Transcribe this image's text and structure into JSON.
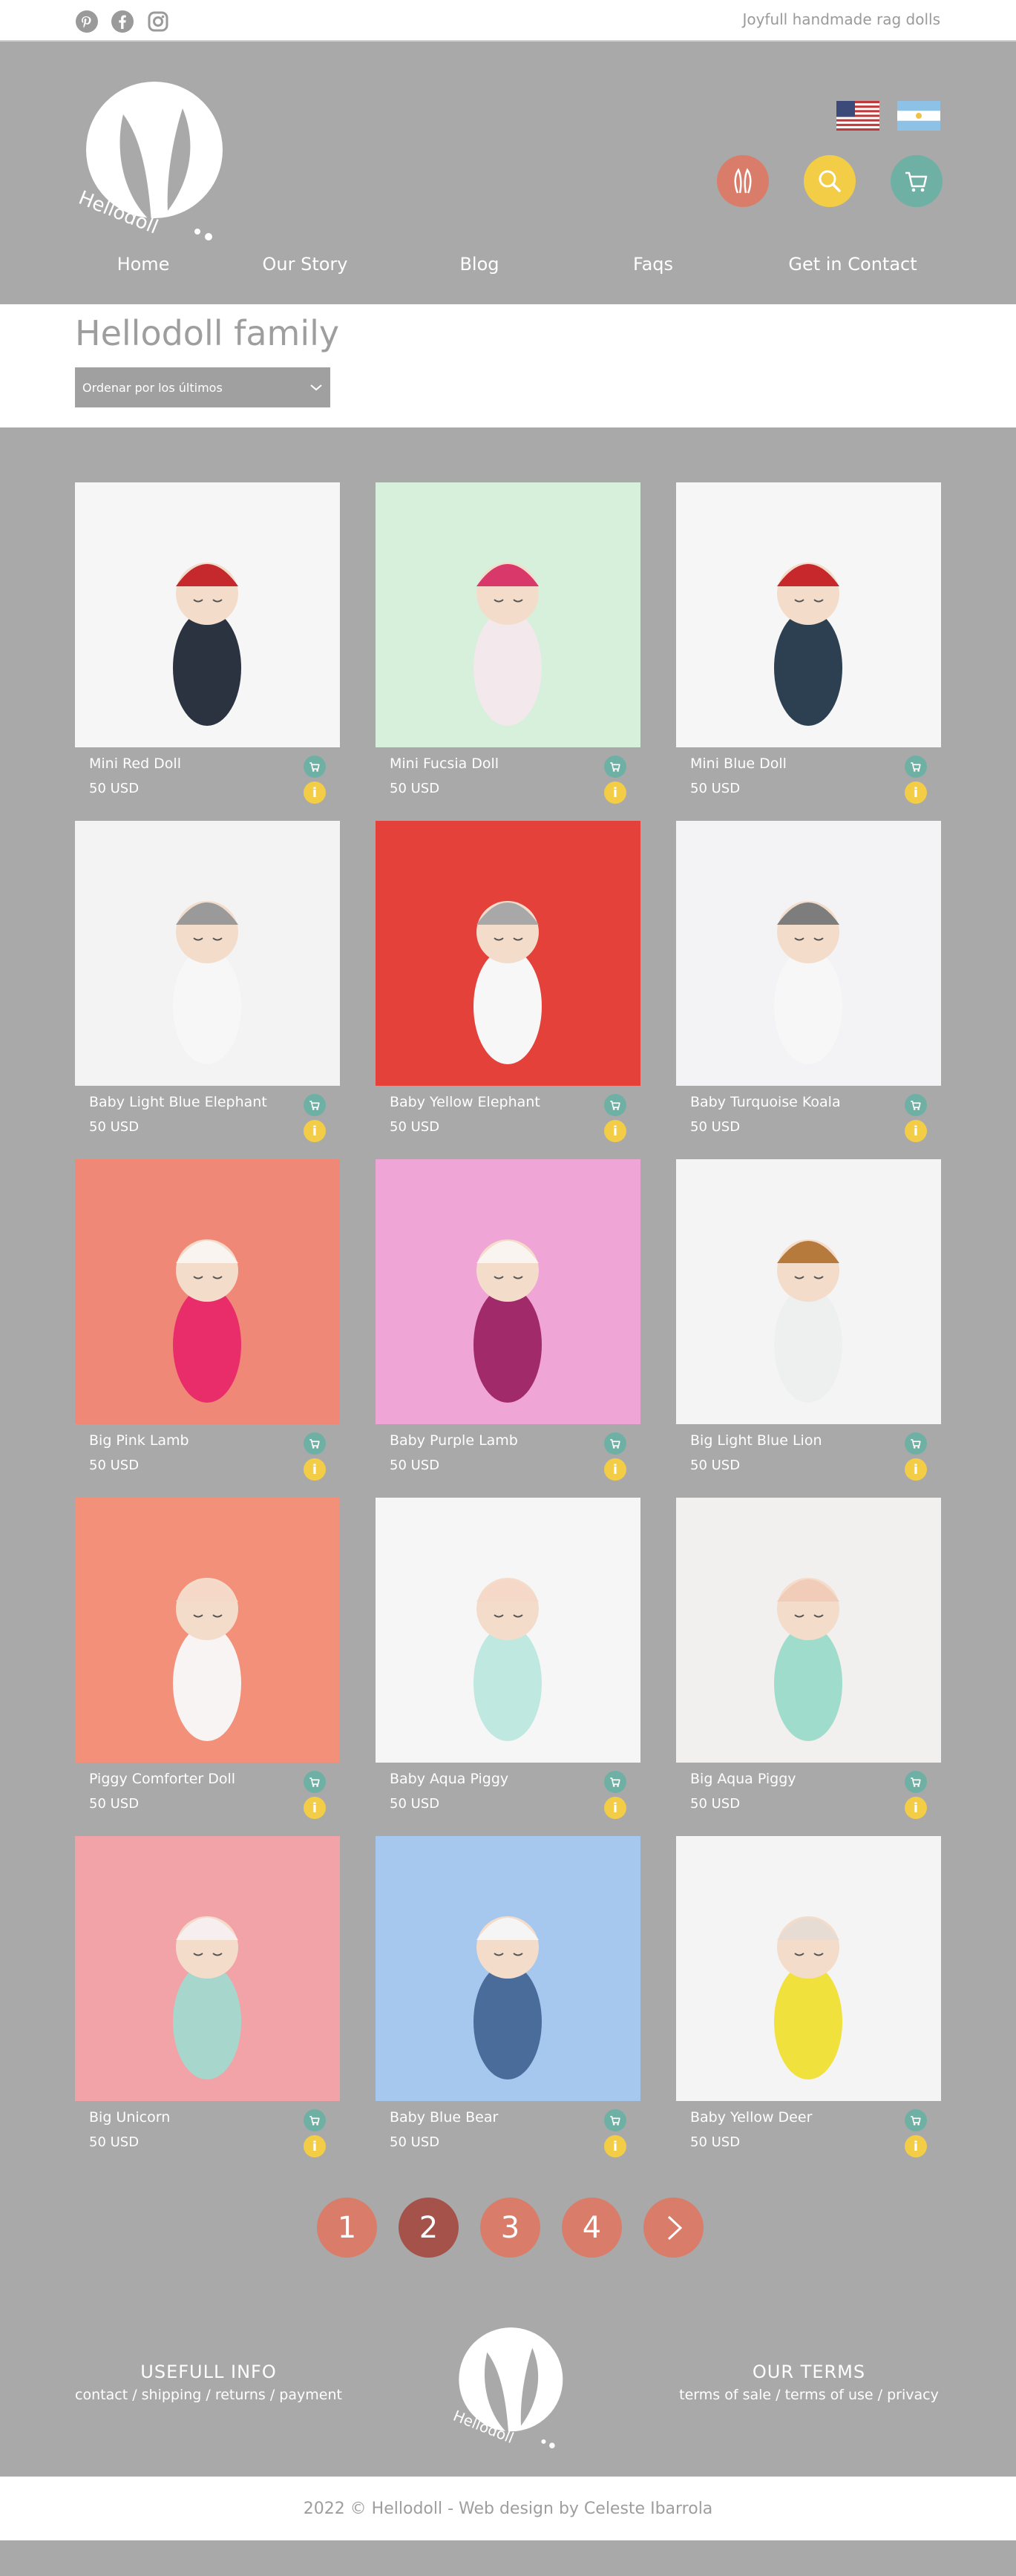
{
  "topbar": {
    "tagline": "Joyfull handmade rag dolls",
    "social": [
      "pinterest-icon",
      "facebook-icon",
      "instagram-icon"
    ]
  },
  "header": {
    "logo_text": "Hellodoll",
    "flags": [
      "us-flag",
      "argentina-flag"
    ],
    "icons": [
      "bunny-ears-icon",
      "search-icon",
      "cart-icon"
    ],
    "nav": [
      "Home",
      "Our Story",
      "Blog",
      "Faqs",
      "Get in Contact"
    ]
  },
  "catalog": {
    "title": "Hellodoll family",
    "sort_label": "Ordenar por los últimos",
    "products": [
      {
        "name": "Mini Red Doll",
        "price": "50 USD",
        "bg": "#f6f6f6",
        "hat": "#c5292d",
        "body": "#2b3240"
      },
      {
        "name": "Mini Fucsia Doll",
        "price": "50 USD",
        "bg": "#d7f0dc",
        "hat": "#d8396a",
        "body": "#f3e8ec"
      },
      {
        "name": "Mini Blue Doll",
        "price": "50 USD",
        "bg": "#f6f6f6",
        "hat": "#c7282c",
        "body": "#2d4051"
      },
      {
        "name": "Baby Light Blue Elephant",
        "price": "50 USD",
        "bg": "#f3f3f3",
        "hat": "#9a9a9a",
        "body": "#f7f7f7"
      },
      {
        "name": "Baby Yellow Elephant",
        "price": "50 USD",
        "bg": "#e4413b",
        "hat": "#a8a8a8",
        "body": "#f7f7f7"
      },
      {
        "name": "Baby Turquoise Koala",
        "price": "50 USD",
        "bg": "#f3f3f5",
        "hat": "#7d7d7d",
        "body": "#f7f7f7"
      },
      {
        "name": "Big Pink Lamb",
        "price": "50 USD",
        "bg": "#f08878",
        "hat": "#f9f4ef",
        "body": "#e92c6a"
      },
      {
        "name": "Baby Purple Lamb",
        "price": "50 USD",
        "bg": "#efa5d6",
        "hat": "#f9f4ef",
        "body": "#a02a6a"
      },
      {
        "name": "Big Light Blue Lion",
        "price": "50 USD",
        "bg": "#f4f4f4",
        "hat": "#b77a3d",
        "body": "#eef0f0"
      },
      {
        "name": "Piggy Comforter Doll",
        "price": "50 USD",
        "bg": "#f3907a",
        "hat": "#f6d8c8",
        "body": "#f8f4f4"
      },
      {
        "name": "Baby Aqua Piggy",
        "price": "50 USD",
        "bg": "#f6f6f6",
        "hat": "#f6d8c8",
        "body": "#bfe8e0"
      },
      {
        "name": "Big Aqua Piggy",
        "price": "50 USD",
        "bg": "#f2efef",
        "hat": "#f1cdb9",
        "body": "#9fdccc"
      },
      {
        "name": "Big Unicorn",
        "price": "50 USD",
        "bg": "#f2a3a8",
        "hat": "#f7eef0",
        "body": "#a6d6cc"
      },
      {
        "name": "Baby Blue Bear",
        "price": "50 USD",
        "bg": "#a7c8ee",
        "hat": "#f5f5f5",
        "body": "#4a6c9b"
      },
      {
        "name": "Baby Yellow Deer",
        "price": "50 USD",
        "bg": "#f4f4f4",
        "hat": "#e7dcd3",
        "body": "#f1e13d"
      }
    ]
  },
  "pagination": {
    "pages": [
      "1",
      "2",
      "3",
      "4"
    ],
    "active": "2",
    "next": "next-arrow-icon"
  },
  "footer": {
    "left_heading": "USEFULL INFO",
    "left_links": "contact / shipping / returns / payment",
    "right_heading": "OUR TERMS",
    "right_links": "terms of sale / terms of use / privacy",
    "logo_text": "Hellodoll",
    "copyright": "2022 © Hellodoll - Web design by Celeste Ibarrola"
  },
  "colors": {
    "background": "#a9a9a9",
    "coral": "#d97d6a",
    "coral_active": "#a5524a",
    "yellow": "#f2cd45",
    "teal": "#6fb0a5"
  }
}
